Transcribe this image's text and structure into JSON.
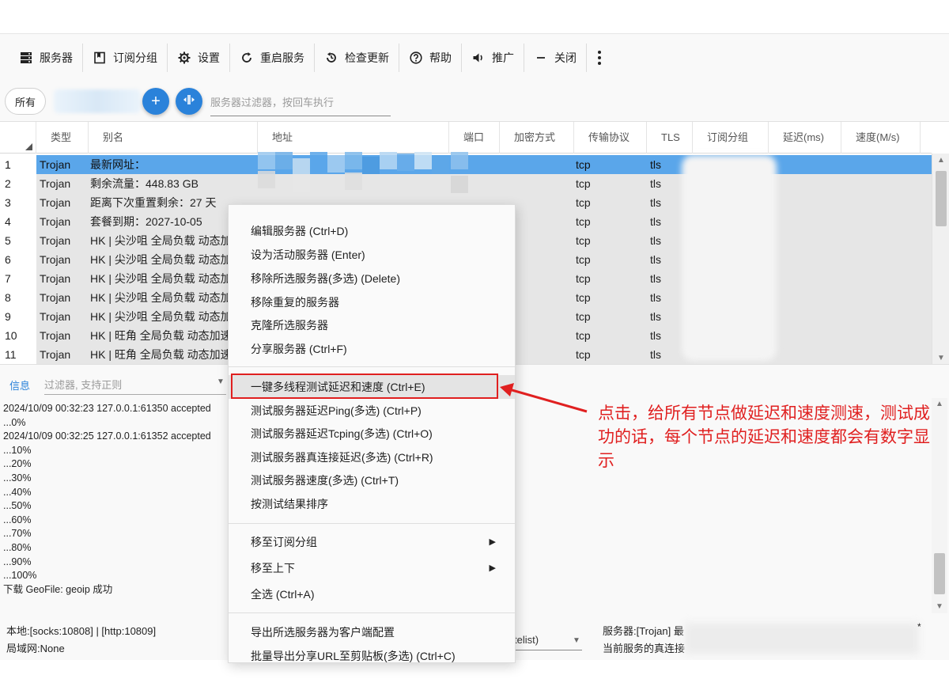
{
  "toolbar": {
    "servers": "服务器",
    "subscription_group": "订阅分组",
    "settings": "设置",
    "restart_service": "重启服务",
    "check_update": "检查更新",
    "help": "帮助",
    "promotion": "推广",
    "close": "关闭"
  },
  "filter_row": {
    "all_label": "所有",
    "add_symbol": "+",
    "filter_placeholder": "服务器过滤器，按回车执行"
  },
  "grid": {
    "columns": [
      "类型",
      "别名",
      "地址",
      "端口",
      "加密方式",
      "传输协议",
      "TLS",
      "订阅分组",
      "延迟(ms)",
      "速度(M/s)"
    ],
    "rows": [
      {
        "num": "1",
        "type": "Trojan",
        "alias": "最新网址：",
        "transport": "tcp",
        "tls": "tls"
      },
      {
        "num": "2",
        "type": "Trojan",
        "alias": "剩余流量：448.83 GB",
        "transport": "tcp",
        "tls": "tls"
      },
      {
        "num": "3",
        "type": "Trojan",
        "alias": "距离下次重置剩余：27 天",
        "transport": "tcp",
        "tls": "tls"
      },
      {
        "num": "4",
        "type": "Trojan",
        "alias": "套餐到期：2027-10-05",
        "transport": "tcp",
        "tls": "tls"
      },
      {
        "num": "5",
        "type": "Trojan",
        "alias": "HK | 尖沙咀 全局负载 动态加",
        "transport": "tcp",
        "tls": "tls"
      },
      {
        "num": "6",
        "type": "Trojan",
        "alias": "HK | 尖沙咀 全局负载 动态加",
        "transport": "tcp",
        "tls": "tls"
      },
      {
        "num": "7",
        "type": "Trojan",
        "alias": "HK | 尖沙咀 全局负载 动态加",
        "transport": "tcp",
        "tls": "tls"
      },
      {
        "num": "8",
        "type": "Trojan",
        "alias": "HK | 尖沙咀 全局负载 动态加",
        "transport": "tcp",
        "tls": "tls"
      },
      {
        "num": "9",
        "type": "Trojan",
        "alias": "HK | 尖沙咀 全局负载 动态加",
        "transport": "tcp",
        "tls": "tls"
      },
      {
        "num": "10",
        "type": "Trojan",
        "alias": "HK | 旺角 全局负载 动态加速",
        "transport": "tcp",
        "tls": "tls"
      },
      {
        "num": "11",
        "type": "Trojan",
        "alias": "HK | 旺角 全局负载 动态加速",
        "transport": "tcp",
        "tls": "tls"
      }
    ]
  },
  "log": {
    "tab_label": "信息",
    "filter_placeholder": "过滤器, 支持正则",
    "lines": [
      "2024/10/09 00:32:23 127.0.0.1:61350 accepted",
      "...0%",
      "2024/10/09 00:32:25 127.0.0.1:61352 accepted",
      "...10%",
      "...20%",
      "...30%",
      "...40%",
      "...50%",
      "...60%",
      "...70%",
      "...80%",
      "...90%",
      "...100%",
      "下载 GeoFile: geoip 成功"
    ]
  },
  "status": {
    "local": "本地:[socks:10808] | [http:10809]",
    "lan": "局域网:None",
    "routing": "telist)",
    "server": "服务器:[Trojan] 最",
    "current": "当前服务的真连接",
    "star": "*"
  },
  "context_menu": {
    "items": [
      "编辑服务器 (Ctrl+D)",
      "设为活动服务器 (Enter)",
      "移除所选服务器(多选) (Delete)",
      "移除重复的服务器",
      "克隆所选服务器",
      "分享服务器 (Ctrl+F)",
      "一键多线程测试延迟和速度 (Ctrl+E)",
      "测试服务器延迟Ping(多选) (Ctrl+P)",
      "测试服务器延迟Tcping(多选) (Ctrl+O)",
      "测试服务器真连接延迟(多选) (Ctrl+R)",
      "测试服务器速度(多选) (Ctrl+T)",
      "按测试结果排序",
      "移至订阅分组",
      "移至上下",
      "全选 (Ctrl+A)",
      "导出所选服务器为客户端配置",
      "批量导出分享URL至剪贴板(多选) (Ctrl+C)"
    ],
    "submenu_glyph": "▶"
  },
  "annotation": {
    "text": "点击，给所有节点做延迟和速度测速，测试成功的话，每个节点的延迟和速度都会有数字显示",
    "color": "#e02020"
  },
  "colors": {
    "accent": "#2a82da",
    "selected_row": "#5aa6ea",
    "annotation_red": "#e02020"
  }
}
